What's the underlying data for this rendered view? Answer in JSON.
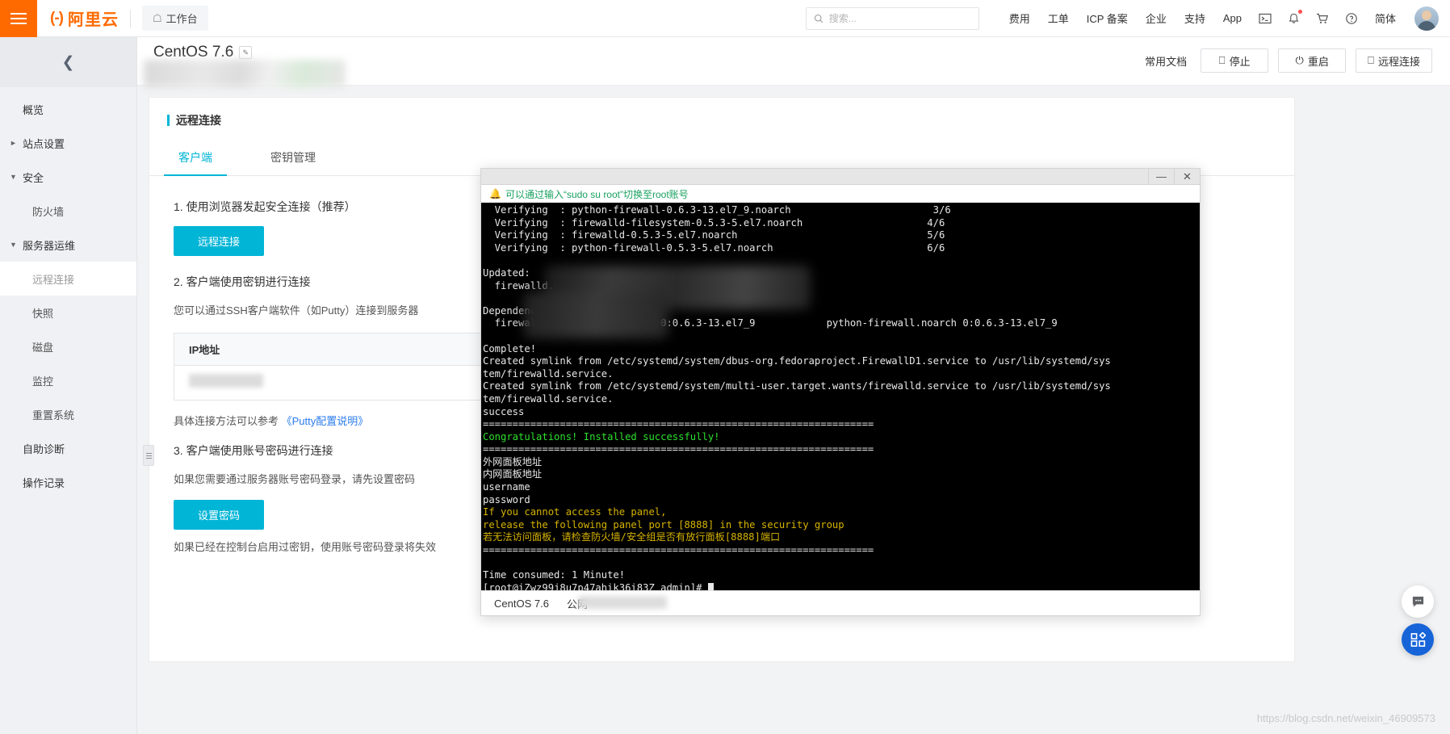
{
  "topbar": {
    "menu_icon": "hamburger-icon",
    "brand_text": "阿里云",
    "workbench_label": "工作台",
    "search_placeholder": "搜索...",
    "nav_links": [
      "费用",
      "工单",
      "ICP 备案",
      "企业",
      "支持",
      "App"
    ],
    "icons": [
      "terminal-icon",
      "bell-icon",
      "cart-icon",
      "help-icon"
    ],
    "lang_label": "简体"
  },
  "sidebar": {
    "collapse_icon": "chevron-left-icon",
    "items": [
      {
        "label": "概览",
        "level": 0,
        "caret": "",
        "active": false
      },
      {
        "label": "站点设置",
        "level": 0,
        "caret": "►",
        "active": false
      },
      {
        "label": "安全",
        "level": 0,
        "caret": "▼",
        "active": false
      },
      {
        "label": "防火墙",
        "level": 1,
        "caret": "",
        "active": false
      },
      {
        "label": "服务器运维",
        "level": 0,
        "caret": "▼",
        "active": false
      },
      {
        "label": "远程连接",
        "level": 1,
        "caret": "",
        "active": true
      },
      {
        "label": "快照",
        "level": 1,
        "caret": "",
        "active": false
      },
      {
        "label": "磁盘",
        "level": 1,
        "caret": "",
        "active": false
      },
      {
        "label": "监控",
        "level": 1,
        "caret": "",
        "active": false
      },
      {
        "label": "重置系统",
        "level": 1,
        "caret": "",
        "active": false
      },
      {
        "label": "自助诊断",
        "level": 0,
        "caret": "",
        "active": false
      },
      {
        "label": "操作记录",
        "level": 0,
        "caret": "",
        "active": false
      }
    ]
  },
  "page": {
    "title": "CentOS 7.6",
    "doc_link": "常用文档",
    "buttons": [
      {
        "label": "停止",
        "icon": "stop-icon"
      },
      {
        "label": "重启",
        "icon": "power-icon"
      },
      {
        "label": "远程连接",
        "icon": "monitor-icon"
      }
    ]
  },
  "card": {
    "title": "远程连接",
    "tabs": [
      {
        "label": "客户端",
        "active": true
      },
      {
        "label": "密钥管理",
        "active": false
      }
    ],
    "step1_heading": "1. 使用浏览器发起安全连接（推荐）",
    "step1_button": "远程连接",
    "step2_heading": "2. 客户端使用密钥进行连接",
    "step2_para": "您可以通过SSH客户端软件（如Putty）连接到服务器",
    "ip_column_header": "IP地址",
    "putty_text_prefix": "具体连接方法可以参考",
    "putty_link": "《Putty配置说明》",
    "step3_heading": "3. 客户端使用账号密码进行连接",
    "step3_para": "如果您需要通过服务器账号密码登录，请先设置密码",
    "step3_button": "设置密码",
    "step3_footnote": "如果已经在控制台启用过密钥，使用账号密码登录将失效"
  },
  "terminal": {
    "minimize_icon": "minimize-icon",
    "close_icon": "close-icon",
    "notice_icon": "bell-icon",
    "notice": "可以通过输入“sudo su root”切换至root账号",
    "lines": [
      {
        "text": "  Verifying  : python-firewall-0.6.3-13.el7_9.noarch                        3/6",
        "color": "white"
      },
      {
        "text": "  Verifying  : firewalld-filesystem-0.5.3-5.el7.noarch                     4/6",
        "color": "white"
      },
      {
        "text": "  Verifying  : firewalld-0.5.3-5.el7.noarch                                5/6",
        "color": "white"
      },
      {
        "text": "  Verifying  : python-firewall-0.5.3-5.el7.noarch                          6/6",
        "color": "white"
      },
      {
        "text": "",
        "color": "white"
      },
      {
        "text": "Updated:",
        "color": "white"
      },
      {
        "text": "  firewalld.noarch 0:0.6.3-13.el7_9",
        "color": "white"
      },
      {
        "text": "",
        "color": "white"
      },
      {
        "text": "Dependency Updated:",
        "color": "white"
      },
      {
        "text": "  firewalld-filesystem.noarch 0:0.6.3-13.el7_9            python-firewall.noarch 0:0.6.3-13.el7_9",
        "color": "white"
      },
      {
        "text": "",
        "color": "white"
      },
      {
        "text": "Complete!",
        "color": "white"
      },
      {
        "text": "Created symlink from /etc/systemd/system/dbus-org.fedoraproject.FirewallD1.service to /usr/lib/systemd/sys",
        "color": "white"
      },
      {
        "text": "tem/firewalld.service.",
        "color": "white"
      },
      {
        "text": "Created symlink from /etc/systemd/system/multi-user.target.wants/firewalld.service to /usr/lib/systemd/sys",
        "color": "white"
      },
      {
        "text": "tem/firewalld.service.",
        "color": "white"
      },
      {
        "text": "success",
        "color": "white"
      },
      {
        "text": "==================================================================",
        "color": "white"
      },
      {
        "text": "Congratulations! Installed successfully!",
        "color": "green"
      },
      {
        "text": "==================================================================",
        "color": "white"
      },
      {
        "text": "外网面板地址",
        "color": "white"
      },
      {
        "text": "内网面板地址",
        "color": "white"
      },
      {
        "text": "username",
        "color": "white"
      },
      {
        "text": "password",
        "color": "white"
      },
      {
        "text": "If you cannot access the panel,",
        "color": "yellow"
      },
      {
        "text": "release the following panel port [8888] in the security group",
        "color": "yellow"
      },
      {
        "text": "若无法访问面板，请检查防火墙/安全组是否有放行面板[8888]端口",
        "color": "yellow"
      },
      {
        "text": "==================================================================",
        "color": "white"
      },
      {
        "text": "",
        "color": "white"
      },
      {
        "text": "Time consumed: 1 Minute!",
        "color": "white"
      },
      {
        "text": "[root@iZwz99j8u7p47ahik36i83Z admin]# ",
        "color": "white"
      }
    ],
    "status_os": "CentOS 7.6",
    "status_network": "公网"
  },
  "floating": {
    "chat_icon": "chat-icon",
    "apps_icon": "apps-grid-icon"
  },
  "watermark": "https://blog.csdn.net/weixin_46909573",
  "colors": {
    "brand_orange": "#ff6a00",
    "accent_cyan": "#00b5d6",
    "link_blue": "#2b7ced",
    "terminal_bg": "#000000",
    "terminal_green": "#2ee02e",
    "terminal_yellow": "#d6b300"
  }
}
